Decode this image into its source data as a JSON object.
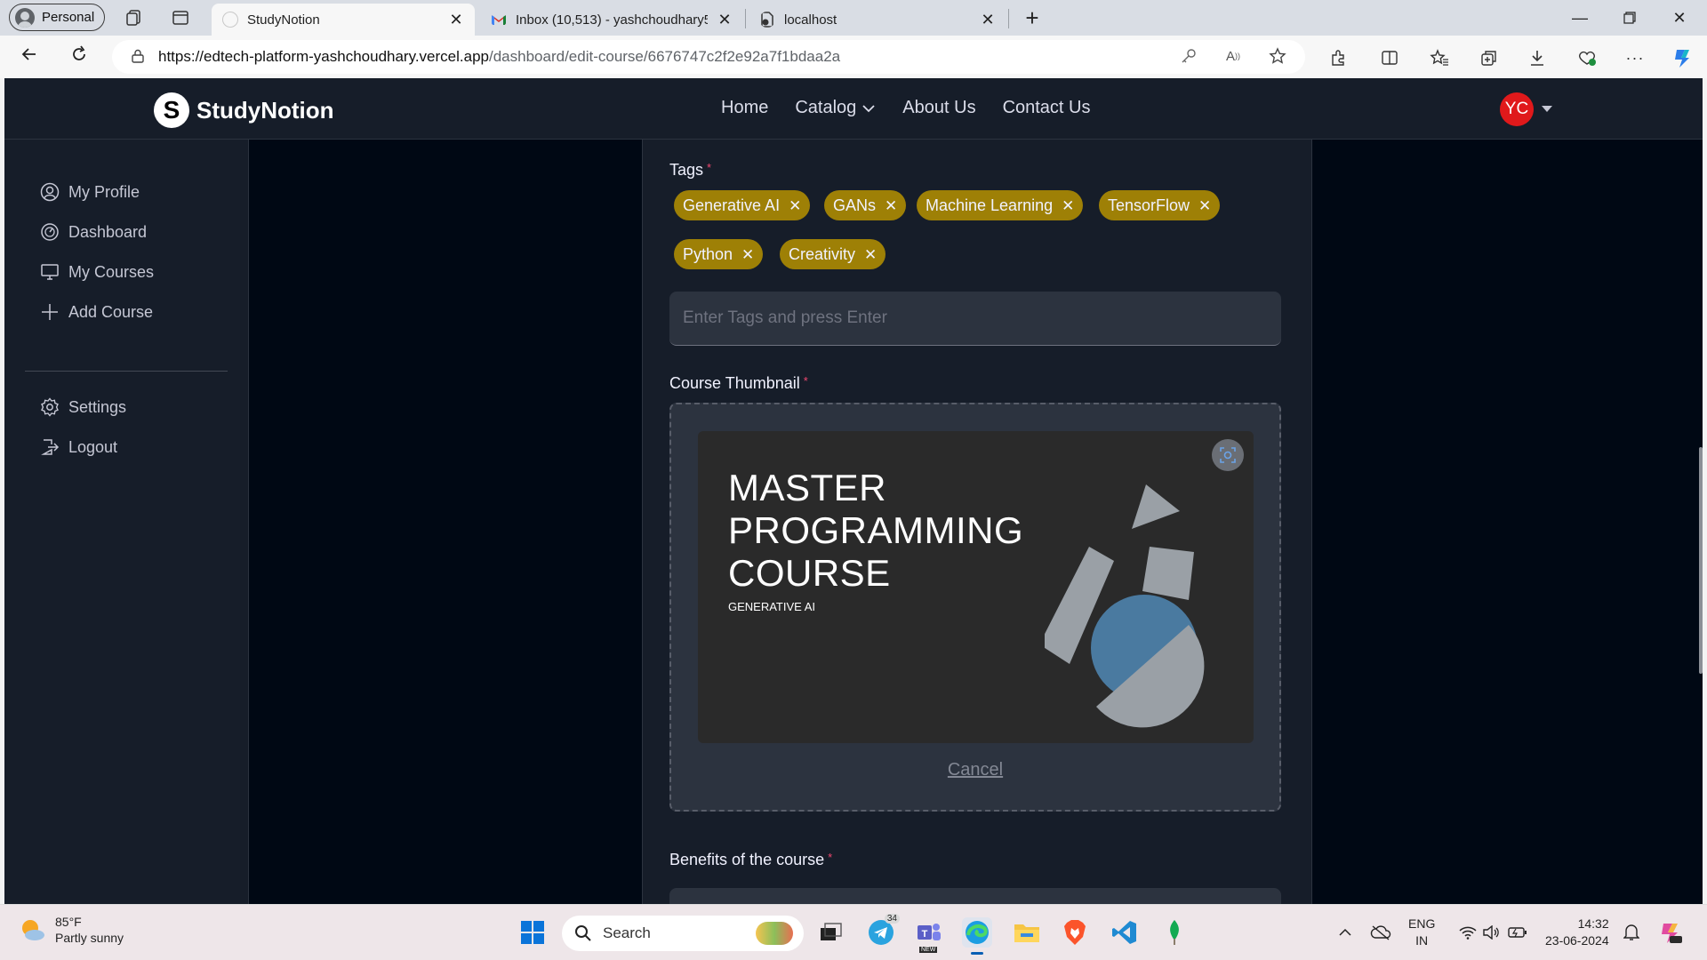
{
  "browser": {
    "profile_label": "Personal",
    "tabs": [
      {
        "title": "StudyNotion",
        "active": true
      },
      {
        "title": "Inbox (10,513) - yashchoudhary5",
        "active": false
      },
      {
        "title": "localhost",
        "active": false
      }
    ],
    "url_host": "https://edtech-platform-yashchoudhary.vercel.app",
    "url_path": "/dashboard/edit-course/6676747c2f2e92a7f1bdaa2a"
  },
  "site": {
    "logo_letter": "S",
    "brand": "StudyNotion",
    "nav": [
      {
        "label": "Home"
      },
      {
        "label": "Catalog"
      },
      {
        "label": "About Us"
      },
      {
        "label": "Contact Us"
      }
    ],
    "user_initials": "YC"
  },
  "sidebar": {
    "items": [
      {
        "label": "My Profile",
        "icon": "profile-icon"
      },
      {
        "label": "Dashboard",
        "icon": "dashboard-icon"
      },
      {
        "label": "My Courses",
        "icon": "monitor-icon"
      },
      {
        "label": "Add Course",
        "icon": "plus-icon"
      }
    ],
    "bottom_items": [
      {
        "label": "Settings",
        "icon": "gear-icon"
      },
      {
        "label": "Logout",
        "icon": "logout-icon"
      }
    ]
  },
  "form": {
    "tags_label": "Tags",
    "required_mark": "*",
    "tags": [
      "Generative AI",
      "GANs",
      "Machine Learning",
      "TensorFlow",
      "Python",
      "Creativity"
    ],
    "tag_remove_glyph": "✕",
    "tag_placeholder": "Enter Tags and press Enter",
    "thumbnail_label": "Course Thumbnail",
    "thumbnail": {
      "title_lines": [
        "MASTER",
        "PROGRAMMING",
        "COURSE"
      ],
      "subtitle": "GENERATIVE AI"
    },
    "cancel_label": "Cancel",
    "benefits_label": "Benefits of the course"
  },
  "taskbar": {
    "temperature": "85°F",
    "weather": "Partly sunny",
    "search_label": "Search",
    "telegram_badge": "34",
    "teams_badge": "NEW",
    "lang_top": "ENG",
    "lang_bottom": "IN",
    "time": "14:32",
    "date": "23-06-2024"
  },
  "colors": {
    "page_bg": "#000814",
    "panel_bg": "#161d29",
    "input_bg": "#2c333f",
    "tag_chip": "#9e8006",
    "required": "#ef476f",
    "avatar": "#e0191b"
  }
}
